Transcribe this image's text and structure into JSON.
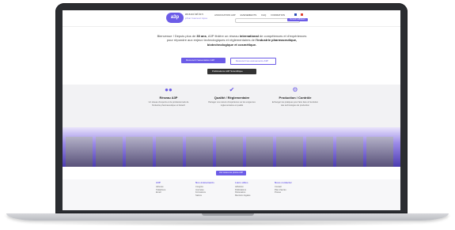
{
  "nav": {
    "logo_text": "a3p",
    "brand_line1": "association",
    "brand_line2": "pharmaceutique",
    "menu": [
      "ASSOCIATION A3P",
      "EVENEMENTS",
      "FAQ",
      "FORMATION"
    ],
    "search_placeholder": "",
    "cta_label": "Devenir adhérent"
  },
  "intro": {
    "part1": "Bienvenue ! Depuis plus de ",
    "years": "30 ans",
    "part2": ", A3P fédère un réseau ",
    "intl": "international",
    "part3": " de compétences et d'expériences pour répondre aux enjeux technologiques et réglementaires de ",
    "industries": "l'industrie pharmaceutique, biotechnologique et cosmétique."
  },
  "buttons": {
    "primary": "Découvrir l'association A3P",
    "outline": "Découvrir les événements A3P",
    "dark": "Publications A3P Scientifique"
  },
  "cards": [
    {
      "icon": "network-icon",
      "title": "Réseau A3P",
      "text": "Un réseau d'experts et de professionnels de l'industrie pharmaceutique et biotech"
    },
    {
      "icon": "check-icon",
      "title": "Qualité / Réglementaire",
      "text": "Partager vos retours d'expérience sur les exigences réglementaires et qualité"
    },
    {
      "icon": "gear-icon",
      "title": "Production / Contrôle",
      "text": "Echanger les pratiques pour faire face à l'évolution des technologies de production"
    }
  ],
  "photos_button": "Voir toutes les photos A3P",
  "footer": {
    "col1": {
      "title": "A3P",
      "lines": [
        "Adresse",
        "Téléphone",
        "Email"
      ]
    },
    "col2": {
      "title": "Nos événements",
      "lines": [
        "Congrès",
        "Journées",
        "Formations",
        "Salons"
      ]
    },
    "col3": {
      "title": "Liens utiles",
      "lines": [
        "Adhésion",
        "Publications",
        "Partenaires",
        "Mentions légales"
      ]
    },
    "col4": {
      "title": "Nous contacter",
      "lines": [
        "Contact",
        "Plan d'accès",
        "Presse"
      ]
    }
  },
  "colors": {
    "accent": "#6c5ce7",
    "dark": "#333333",
    "band": "#f2f2f4"
  }
}
